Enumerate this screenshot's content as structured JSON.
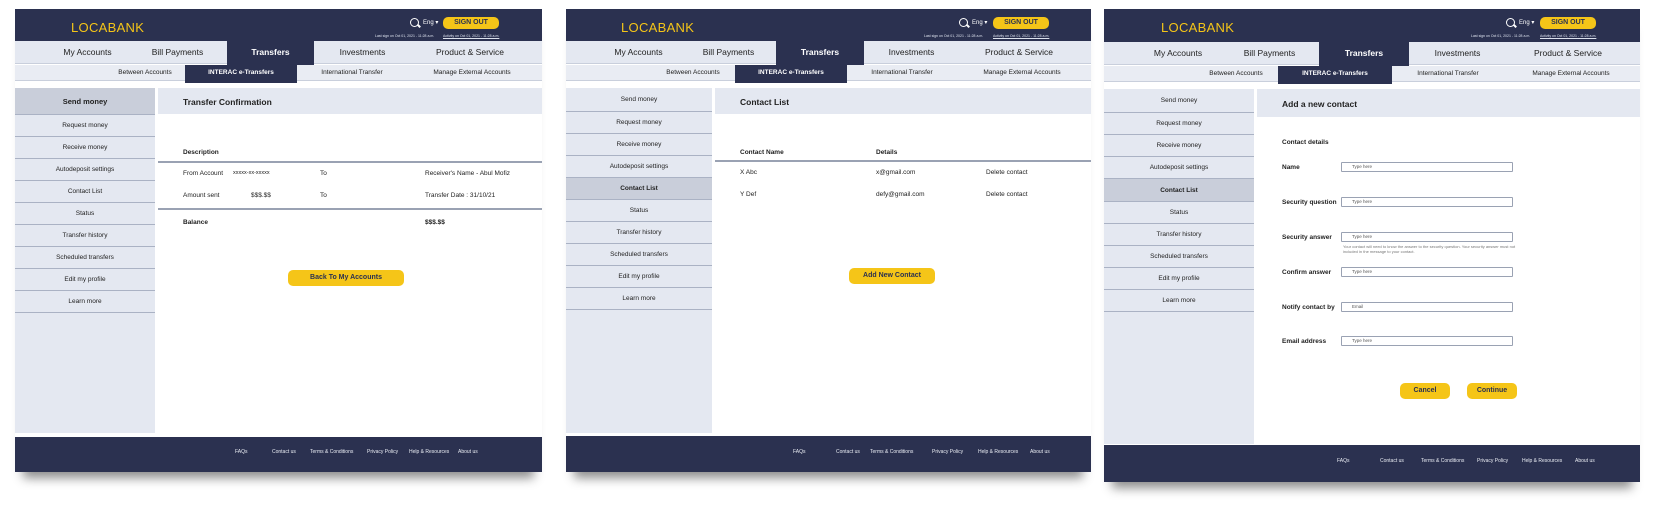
{
  "brand": {
    "logo": "LOCABANK",
    "lang": "Eng ▾",
    "sign_out": "SIGN OUT",
    "last_sign": "Last sign on Oct 01, 2021 - 11:28 a.m.",
    "activity": "Activity on Oct 01, 2021 - 11:28 a.m."
  },
  "colors": {
    "navy": "#2b3150",
    "accent": "#f5c518",
    "panel": "#e4e8f1"
  },
  "nav": [
    "My Accounts",
    "Bill Payments",
    "Transfers",
    "Investments",
    "Product & Service"
  ],
  "subnav": [
    "Between Accounts",
    "INTERAC e-Transfers",
    "International Transfer",
    "Manage External Accounts"
  ],
  "sidebar": [
    "Send money",
    "Request money",
    "Receive money",
    "Autodeposit settings",
    "Contact List",
    "Status",
    "Transfer history",
    "Scheduled transfers",
    "Edit my profile",
    "Learn more"
  ],
  "footer": [
    "FAQs",
    "Contact us",
    "Terms & Conditions",
    "Privacy Policy",
    "Help & Resources",
    "About us"
  ],
  "confirmation": {
    "title": "Transfer Confirmation",
    "description": "Description",
    "row1": {
      "label": "From Account",
      "value": "xxxxx-xx-xxxxx",
      "to": "To",
      "right": "Receiver's Name - Abul Mofiz"
    },
    "row2": {
      "label": "Amount sent",
      "value": "$$$.$$",
      "to": "To",
      "right": "Transfer Date : 31/10/21"
    },
    "balance_label": "Balance",
    "balance_value": "$$$.$$",
    "button": "Back To  My Accounts"
  },
  "contacts": {
    "title": "Contact List",
    "col_name": "Contact Name",
    "col_details": "Details",
    "rows": [
      {
        "name": "X Abc",
        "email": "x@gmail.com",
        "action": "Delete contact"
      },
      {
        "name": "Y Def",
        "email": "defy@gmail.com",
        "action": "Delete contact"
      }
    ],
    "button": "Add New Contact"
  },
  "new_contact": {
    "title": "Add a new contact",
    "section": "Contact details",
    "fields": [
      {
        "label": "Name",
        "placeholder": "Type here"
      },
      {
        "label": "Security question",
        "placeholder": "Type here"
      },
      {
        "label": "Security answer",
        "placeholder": "Type here"
      },
      {
        "label": "Confirm answer",
        "placeholder": "Type here"
      },
      {
        "label": "Notify contact by",
        "placeholder": "Email"
      },
      {
        "label": "Email address",
        "placeholder": "Type here"
      }
    ],
    "hint": "Your contact will need to know the answer to the security question. Your security answer must not included in the message to your contact.",
    "cancel": "Cancel",
    "continue": "Continue"
  }
}
